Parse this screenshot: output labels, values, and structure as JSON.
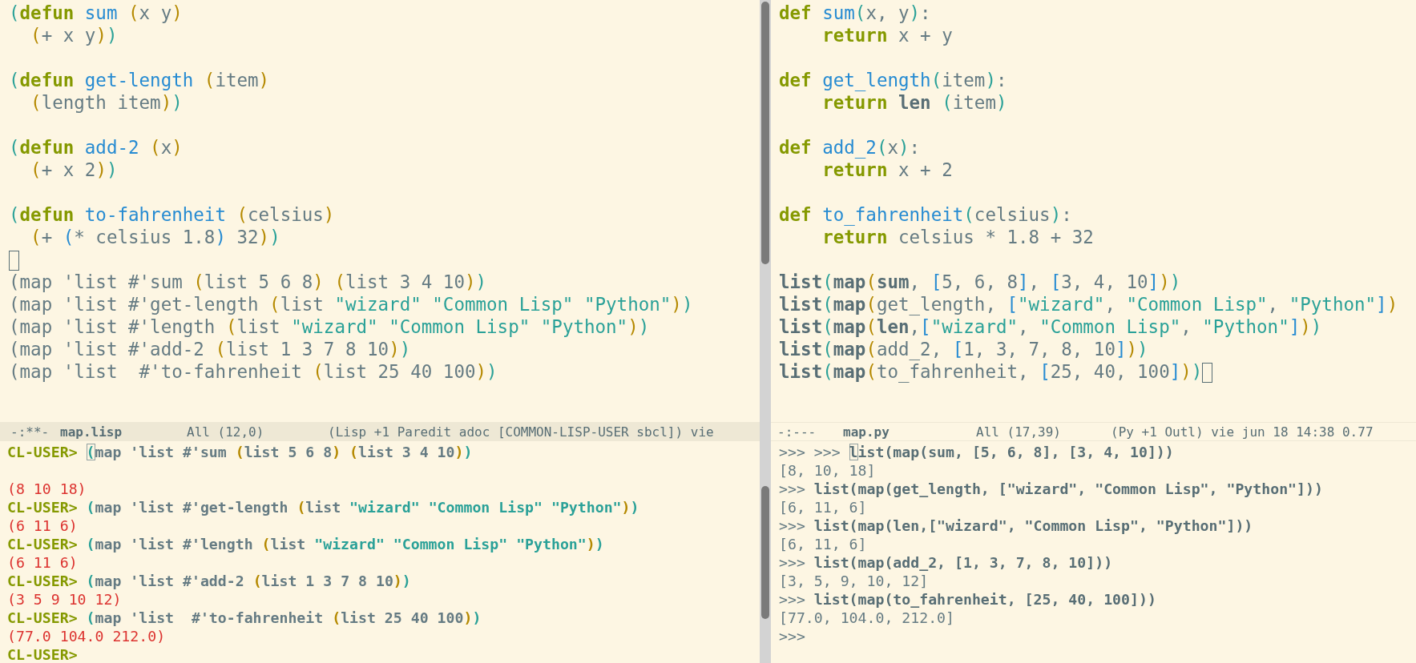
{
  "lisp_editor": {
    "lines": [
      {
        "kind": "code",
        "tokens": [
          {
            "text": "(",
            "kind": "p1"
          },
          {
            "text": "defun",
            "kind": "kw"
          },
          {
            "text": " sum",
            "kind": "fn"
          },
          {
            "text": " (",
            "kind": "p2"
          },
          {
            "text": "x y",
            "kind": "plain"
          },
          {
            "text": ")",
            "kind": "p2"
          }
        ]
      },
      {
        "kind": "code",
        "tokens": [
          {
            "text": "  (",
            "kind": "p2"
          },
          {
            "text": "+ x y",
            "kind": "plain"
          },
          {
            "text": ")",
            "kind": "p2"
          },
          {
            "text": ")",
            "kind": "p1"
          }
        ]
      },
      {
        "kind": "blank"
      },
      {
        "kind": "code",
        "tokens": [
          {
            "text": "(",
            "kind": "p1"
          },
          {
            "text": "defun",
            "kind": "kw"
          },
          {
            "text": " get-length",
            "kind": "fn"
          },
          {
            "text": " (",
            "kind": "p2"
          },
          {
            "text": "item",
            "kind": "plain"
          },
          {
            "text": ")",
            "kind": "p2"
          }
        ]
      },
      {
        "kind": "code",
        "tokens": [
          {
            "text": "  (",
            "kind": "p2"
          },
          {
            "text": "length item",
            "kind": "plain"
          },
          {
            "text": ")",
            "kind": "p2"
          },
          {
            "text": ")",
            "kind": "p1"
          }
        ]
      },
      {
        "kind": "blank"
      },
      {
        "kind": "code",
        "tokens": [
          {
            "text": "(",
            "kind": "p1"
          },
          {
            "text": "defun",
            "kind": "kw"
          },
          {
            "text": " add-2",
            "kind": "fn"
          },
          {
            "text": " (",
            "kind": "p2"
          },
          {
            "text": "x",
            "kind": "plain"
          },
          {
            "text": ")",
            "kind": "p2"
          }
        ]
      },
      {
        "kind": "code",
        "tokens": [
          {
            "text": "  (",
            "kind": "p2"
          },
          {
            "text": "+ x 2",
            "kind": "plain"
          },
          {
            "text": ")",
            "kind": "p2"
          },
          {
            "text": ")",
            "kind": "p1"
          }
        ]
      },
      {
        "kind": "blank"
      },
      {
        "kind": "code",
        "tokens": [
          {
            "text": "(",
            "kind": "p1"
          },
          {
            "text": "defun",
            "kind": "kw"
          },
          {
            "text": " to-fahrenheit",
            "kind": "fn"
          },
          {
            "text": " (",
            "kind": "p2"
          },
          {
            "text": "celsius",
            "kind": "plain"
          },
          {
            "text": ")",
            "kind": "p2"
          }
        ]
      },
      {
        "kind": "code",
        "tokens": [
          {
            "text": "  (",
            "kind": "p2"
          },
          {
            "text": "+ ",
            "kind": "plain"
          },
          {
            "text": "(",
            "kind": "p3"
          },
          {
            "text": "* celsius 1.8",
            "kind": "plain"
          },
          {
            "text": ")",
            "kind": "p3"
          },
          {
            "text": " 32",
            "kind": "plain"
          },
          {
            "text": ")",
            "kind": "p2"
          },
          {
            "text": ")",
            "kind": "p1"
          }
        ]
      },
      {
        "kind": "cursor"
      },
      {
        "kind": "code",
        "tokens": [
          {
            "text": "(map 'list #'sum ",
            "kind": "plain"
          },
          {
            "text": "(",
            "kind": "p2"
          },
          {
            "text": "list 5 6 8",
            "kind": "plain"
          },
          {
            "text": ")",
            "kind": "p2"
          },
          {
            "text": " (",
            "kind": "p2"
          },
          {
            "text": "list 3 4 10",
            "kind": "plain"
          },
          {
            "text": ")",
            "kind": "p2"
          },
          {
            "text": ")",
            "kind": "p1"
          }
        ]
      },
      {
        "kind": "code",
        "tokens": [
          {
            "text": "(map 'list #'get-length ",
            "kind": "plain"
          },
          {
            "text": "(",
            "kind": "p2"
          },
          {
            "text": "list ",
            "kind": "plain"
          },
          {
            "text": "\"wizard\"",
            "kind": "str"
          },
          {
            "text": " \"Common Lisp\"",
            "kind": "str"
          },
          {
            "text": " \"Python\"",
            "kind": "str"
          },
          {
            "text": ")",
            "kind": "p2"
          },
          {
            "text": ")",
            "kind": "p1"
          }
        ]
      },
      {
        "kind": "code",
        "tokens": [
          {
            "text": "(map 'list #'length ",
            "kind": "plain"
          },
          {
            "text": "(",
            "kind": "p2"
          },
          {
            "text": "list ",
            "kind": "plain"
          },
          {
            "text": "\"wizard\"",
            "kind": "str"
          },
          {
            "text": " \"Common Lisp\"",
            "kind": "str"
          },
          {
            "text": " \"Python\"",
            "kind": "str"
          },
          {
            "text": ")",
            "kind": "p2"
          },
          {
            "text": ")",
            "kind": "p1"
          }
        ]
      },
      {
        "kind": "code",
        "tokens": [
          {
            "text": "(map 'list #'add-2 ",
            "kind": "plain"
          },
          {
            "text": "(",
            "kind": "p2"
          },
          {
            "text": "list 1 3 7 8 10",
            "kind": "plain"
          },
          {
            "text": ")",
            "kind": "p2"
          },
          {
            "text": ")",
            "kind": "p1"
          }
        ]
      },
      {
        "kind": "code",
        "tokens": [
          {
            "text": "(map 'list  #'to-fahrenheit ",
            "kind": "plain"
          },
          {
            "text": "(",
            "kind": "p2"
          },
          {
            "text": "list 25 40 100",
            "kind": "plain"
          },
          {
            "text": ")",
            "kind": "p2"
          },
          {
            "text": ")",
            "kind": "p1"
          }
        ]
      }
    ]
  },
  "python_editor": {
    "lines": [
      {
        "kind": "code",
        "tokens": [
          {
            "text": "def",
            "kind": "kw"
          },
          {
            "text": " sum",
            "kind": "fn"
          },
          {
            "text": "(",
            "kind": "p1"
          },
          {
            "text": "x, y",
            "kind": "plain"
          },
          {
            "text": ")",
            "kind": "p1"
          },
          {
            "text": ":",
            "kind": "plain"
          }
        ]
      },
      {
        "kind": "code",
        "tokens": [
          {
            "text": "    return",
            "kind": "kw"
          },
          {
            "text": " x + y",
            "kind": "plain"
          }
        ]
      },
      {
        "kind": "blank"
      },
      {
        "kind": "code",
        "tokens": [
          {
            "text": "def",
            "kind": "kw"
          },
          {
            "text": " get_length",
            "kind": "fn"
          },
          {
            "text": "(",
            "kind": "p1"
          },
          {
            "text": "item",
            "kind": "plain"
          },
          {
            "text": ")",
            "kind": "p1"
          },
          {
            "text": ":",
            "kind": "plain"
          }
        ]
      },
      {
        "kind": "code",
        "tokens": [
          {
            "text": "    return",
            "kind": "kw"
          },
          {
            "text": " len",
            "kind": "bold"
          },
          {
            "text": " (",
            "kind": "p1"
          },
          {
            "text": "item",
            "kind": "plain"
          },
          {
            "text": ")",
            "kind": "p1"
          }
        ]
      },
      {
        "kind": "blank"
      },
      {
        "kind": "code",
        "tokens": [
          {
            "text": "def",
            "kind": "kw"
          },
          {
            "text": " add_2",
            "kind": "fn"
          },
          {
            "text": "(",
            "kind": "p1"
          },
          {
            "text": "x",
            "kind": "plain"
          },
          {
            "text": ")",
            "kind": "p1"
          },
          {
            "text": ":",
            "kind": "plain"
          }
        ]
      },
      {
        "kind": "code",
        "tokens": [
          {
            "text": "    return",
            "kind": "kw"
          },
          {
            "text": " x + 2",
            "kind": "plain"
          }
        ]
      },
      {
        "kind": "blank"
      },
      {
        "kind": "code",
        "tokens": [
          {
            "text": "def",
            "kind": "kw"
          },
          {
            "text": " to_fahrenheit",
            "kind": "fn"
          },
          {
            "text": "(",
            "kind": "p1"
          },
          {
            "text": "celsius",
            "kind": "plain"
          },
          {
            "text": ")",
            "kind": "p1"
          },
          {
            "text": ":",
            "kind": "plain"
          }
        ]
      },
      {
        "kind": "code",
        "tokens": [
          {
            "text": "    return",
            "kind": "kw"
          },
          {
            "text": " celsius * 1.8 + 32",
            "kind": "plain"
          }
        ]
      },
      {
        "kind": "blank"
      },
      {
        "kind": "code",
        "tokens": [
          {
            "text": "list",
            "kind": "bold"
          },
          {
            "text": "(",
            "kind": "p1"
          },
          {
            "text": "map",
            "kind": "bold"
          },
          {
            "text": "(",
            "kind": "p2"
          },
          {
            "text": "sum",
            "kind": "bold"
          },
          {
            "text": ", ",
            "kind": "plain"
          },
          {
            "text": "[",
            "kind": "p3"
          },
          {
            "text": "5, 6, 8",
            "kind": "plain"
          },
          {
            "text": "]",
            "kind": "p3"
          },
          {
            "text": ", ",
            "kind": "plain"
          },
          {
            "text": "[",
            "kind": "p3"
          },
          {
            "text": "3, 4, 10",
            "kind": "plain"
          },
          {
            "text": "]",
            "kind": "p3"
          },
          {
            "text": ")",
            "kind": "p2"
          },
          {
            "text": ")",
            "kind": "p1"
          }
        ]
      },
      {
        "kind": "code",
        "tokens": [
          {
            "text": "list",
            "kind": "bold"
          },
          {
            "text": "(",
            "kind": "p1"
          },
          {
            "text": "map",
            "kind": "bold"
          },
          {
            "text": "(",
            "kind": "p2"
          },
          {
            "text": "get_length, ",
            "kind": "plain"
          },
          {
            "text": "[",
            "kind": "p3"
          },
          {
            "text": "\"wizard\"",
            "kind": "str"
          },
          {
            "text": ", ",
            "kind": "plain"
          },
          {
            "text": "\"Common Lisp\"",
            "kind": "str"
          },
          {
            "text": ", ",
            "kind": "plain"
          },
          {
            "text": "\"Python\"",
            "kind": "str"
          },
          {
            "text": "]",
            "kind": "p3"
          },
          {
            "text": ")",
            "kind": "p2"
          }
        ]
      },
      {
        "kind": "code",
        "tokens": [
          {
            "text": "list",
            "kind": "bold"
          },
          {
            "text": "(",
            "kind": "p1"
          },
          {
            "text": "map",
            "kind": "bold"
          },
          {
            "text": "(",
            "kind": "p2"
          },
          {
            "text": "len",
            "kind": "bold"
          },
          {
            "text": ",",
            "kind": "plain"
          },
          {
            "text": "[",
            "kind": "p3"
          },
          {
            "text": "\"wizard\"",
            "kind": "str"
          },
          {
            "text": ", ",
            "kind": "plain"
          },
          {
            "text": "\"Common Lisp\"",
            "kind": "str"
          },
          {
            "text": ", ",
            "kind": "plain"
          },
          {
            "text": "\"Python\"",
            "kind": "str"
          },
          {
            "text": "]",
            "kind": "p3"
          },
          {
            "text": ")",
            "kind": "p2"
          },
          {
            "text": ")",
            "kind": "p1"
          }
        ]
      },
      {
        "kind": "code",
        "tokens": [
          {
            "text": "list",
            "kind": "bold"
          },
          {
            "text": "(",
            "kind": "p1"
          },
          {
            "text": "map",
            "kind": "bold"
          },
          {
            "text": "(",
            "kind": "p2"
          },
          {
            "text": "add_2, ",
            "kind": "plain"
          },
          {
            "text": "[",
            "kind": "p3"
          },
          {
            "text": "1, 3, 7, 8, 10",
            "kind": "plain"
          },
          {
            "text": "]",
            "kind": "p3"
          },
          {
            "text": ")",
            "kind": "p2"
          },
          {
            "text": ")",
            "kind": "p1"
          }
        ]
      },
      {
        "kind": "code",
        "tokens": [
          {
            "text": "list",
            "kind": "bold"
          },
          {
            "text": "(",
            "kind": "p1"
          },
          {
            "text": "map",
            "kind": "bold"
          },
          {
            "text": "(",
            "kind": "p2"
          },
          {
            "text": "to_fahrenheit, ",
            "kind": "plain"
          },
          {
            "text": "[",
            "kind": "p3"
          },
          {
            "text": "25, 40, 100",
            "kind": "plain"
          },
          {
            "text": "]",
            "kind": "p3"
          },
          {
            "text": ")",
            "kind": "p2"
          },
          {
            "text": ")",
            "kind": "p1"
          },
          {
            "kind": "cursor"
          }
        ]
      }
    ]
  },
  "mode_lines": [
    {
      "status": "-:**-",
      "file": "map.lisp",
      "position": "All (12,0)",
      "modes": "(Lisp +1 Paredit adoc [COMMON-LISP-USER sbcl]) vie",
      "active": true
    },
    {
      "status": "-:---",
      "file": "map.py",
      "position": "All (17,39)",
      "modes": "(Py +1 Outl) vie jun 18 14:38 0.77",
      "active": false
    }
  ],
  "lisp_repl": {
    "lines": [
      {
        "kind": "code",
        "tokens": [
          {
            "text": "CL-USER> ",
            "kind": "prompt"
          },
          {
            "text": "(",
            "kind": "cursor"
          },
          {
            "text": "map 'list #'sum ",
            "kind": "plain"
          },
          {
            "text": "(",
            "kind": "p2"
          },
          {
            "text": "list 5 6 8",
            "kind": "plain"
          },
          {
            "text": ")",
            "kind": "p2"
          },
          {
            "text": " (",
            "kind": "p2"
          },
          {
            "text": "list 3 4 10",
            "kind": "plain"
          },
          {
            "text": ")",
            "kind": "p2"
          },
          {
            "text": ")",
            "kind": "p1"
          }
        ]
      },
      {
        "kind": "blank"
      },
      {
        "kind": "code",
        "tokens": [
          {
            "text": "(8 10 18)",
            "kind": "out"
          }
        ]
      },
      {
        "kind": "code",
        "tokens": [
          {
            "text": "CL-USER> ",
            "kind": "prompt"
          },
          {
            "text": "(",
            "kind": "p1"
          },
          {
            "text": "map 'list #'get-length ",
            "kind": "plain"
          },
          {
            "text": "(",
            "kind": "p2"
          },
          {
            "text": "list ",
            "kind": "plain"
          },
          {
            "text": "\"wizard\"",
            "kind": "str"
          },
          {
            "text": " \"Common Lisp\"",
            "kind": "str"
          },
          {
            "text": " \"Python\"",
            "kind": "str"
          },
          {
            "text": ")",
            "kind": "p2"
          },
          {
            "text": ")",
            "kind": "p1"
          }
        ]
      },
      {
        "kind": "code",
        "tokens": [
          {
            "text": "(6 11 6)",
            "kind": "out"
          }
        ]
      },
      {
        "kind": "code",
        "tokens": [
          {
            "text": "CL-USER> ",
            "kind": "prompt"
          },
          {
            "text": "(",
            "kind": "p1"
          },
          {
            "text": "map 'list #'length ",
            "kind": "plain"
          },
          {
            "text": "(",
            "kind": "p2"
          },
          {
            "text": "list ",
            "kind": "plain"
          },
          {
            "text": "\"wizard\"",
            "kind": "str"
          },
          {
            "text": " \"Common Lisp\"",
            "kind": "str"
          },
          {
            "text": " \"Python\"",
            "kind": "str"
          },
          {
            "text": ")",
            "kind": "p2"
          },
          {
            "text": ")",
            "kind": "p1"
          }
        ]
      },
      {
        "kind": "code",
        "tokens": [
          {
            "text": "(6 11 6)",
            "kind": "out"
          }
        ]
      },
      {
        "kind": "code",
        "tokens": [
          {
            "text": "CL-USER> ",
            "kind": "prompt"
          },
          {
            "text": "(",
            "kind": "p1"
          },
          {
            "text": "map 'list #'add-2 ",
            "kind": "plain"
          },
          {
            "text": "(",
            "kind": "p2"
          },
          {
            "text": "list 1 3 7 8 10",
            "kind": "plain"
          },
          {
            "text": ")",
            "kind": "p2"
          },
          {
            "text": ")",
            "kind": "p1"
          }
        ]
      },
      {
        "kind": "code",
        "tokens": [
          {
            "text": "(3 5 9 10 12)",
            "kind": "out"
          }
        ]
      },
      {
        "kind": "code",
        "tokens": [
          {
            "text": "CL-USER> ",
            "kind": "prompt"
          },
          {
            "text": "(",
            "kind": "p1"
          },
          {
            "text": "map 'list  #'to-fahrenheit ",
            "kind": "plain"
          },
          {
            "text": "(",
            "kind": "p2"
          },
          {
            "text": "list 25 40 100",
            "kind": "plain"
          },
          {
            "text": ")",
            "kind": "p2"
          },
          {
            "text": ")",
            "kind": "p1"
          }
        ]
      },
      {
        "kind": "code",
        "tokens": [
          {
            "text": "(77.0 104.0 212.0)",
            "kind": "out"
          }
        ]
      },
      {
        "kind": "code",
        "tokens": [
          {
            "text": "CL-USER>",
            "kind": "prompt"
          }
        ]
      }
    ]
  },
  "python_repl": {
    "lines": [
      {
        "kind": "code",
        "tokens": [
          {
            "text": ">>> >>> ",
            "kind": "plain"
          },
          {
            "text": "l",
            "kind": "cursor"
          },
          {
            "text": "ist(map(sum, [5, 6, 8], [3, 4, 10]))",
            "kind": "bold"
          }
        ]
      },
      {
        "kind": "code",
        "tokens": [
          {
            "text": "[8, 10, 18]",
            "kind": "plain"
          }
        ]
      },
      {
        "kind": "code",
        "tokens": [
          {
            "text": ">>> ",
            "kind": "plain"
          },
          {
            "text": "list(map(get_length, [\"wizard\", \"Common Lisp\", \"Python\"]))",
            "kind": "bold"
          }
        ]
      },
      {
        "kind": "code",
        "tokens": [
          {
            "text": "[6, 11, 6]",
            "kind": "plain"
          }
        ]
      },
      {
        "kind": "code",
        "tokens": [
          {
            "text": ">>> ",
            "kind": "plain"
          },
          {
            "text": "list(map(len,[\"wizard\", \"Common Lisp\", \"Python\"]))",
            "kind": "bold"
          }
        ]
      },
      {
        "kind": "code",
        "tokens": [
          {
            "text": "[6, 11, 6]",
            "kind": "plain"
          }
        ]
      },
      {
        "kind": "code",
        "tokens": [
          {
            "text": ">>> ",
            "kind": "plain"
          },
          {
            "text": "list(map(add_2, [1, 3, 7, 8, 10]))",
            "kind": "bold"
          }
        ]
      },
      {
        "kind": "code",
        "tokens": [
          {
            "text": "[3, 5, 9, 10, 12]",
            "kind": "plain"
          }
        ]
      },
      {
        "kind": "code",
        "tokens": [
          {
            "text": ">>> ",
            "kind": "plain"
          },
          {
            "text": "list(map(to_fahrenheit, [25, 40, 100]))",
            "kind": "bold"
          }
        ]
      },
      {
        "kind": "code",
        "tokens": [
          {
            "text": "[77.0, 104.0, 212.0]",
            "kind": "plain"
          }
        ]
      },
      {
        "kind": "code",
        "tokens": [
          {
            "text": ">>>",
            "kind": "plain"
          }
        ]
      }
    ]
  }
}
